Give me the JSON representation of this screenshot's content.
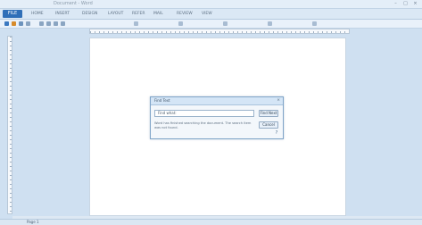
{
  "window": {
    "title": "Document - Word",
    "controls": [
      "–",
      "□",
      "×"
    ]
  },
  "ribbon": {
    "file_tab": "FILE",
    "tabs": [
      "HOME",
      "INSERT",
      "DESIGN",
      "LAYOUT",
      "REFER",
      "MAIL",
      "REVIEW",
      "VIEW"
    ]
  },
  "toolbar": {
    "icons": [
      "save-icon",
      "undo-icon",
      "redo-icon",
      "print-icon",
      "bold-icon",
      "italic-icon",
      "underline-icon",
      "align-icon"
    ]
  },
  "dialog": {
    "title": "Find Text",
    "close": "×",
    "input_value": "Find what:",
    "find_button": "Find Next",
    "cancel_button": "Cancel",
    "message": "Word has finished searching the document. The search item was not found.",
    "help": "?"
  },
  "statusbar": {
    "page_info": "Page 1"
  },
  "colors": {
    "accent": "#2f6fb8",
    "background": "#cfe0f1",
    "page": "#ffffff"
  }
}
